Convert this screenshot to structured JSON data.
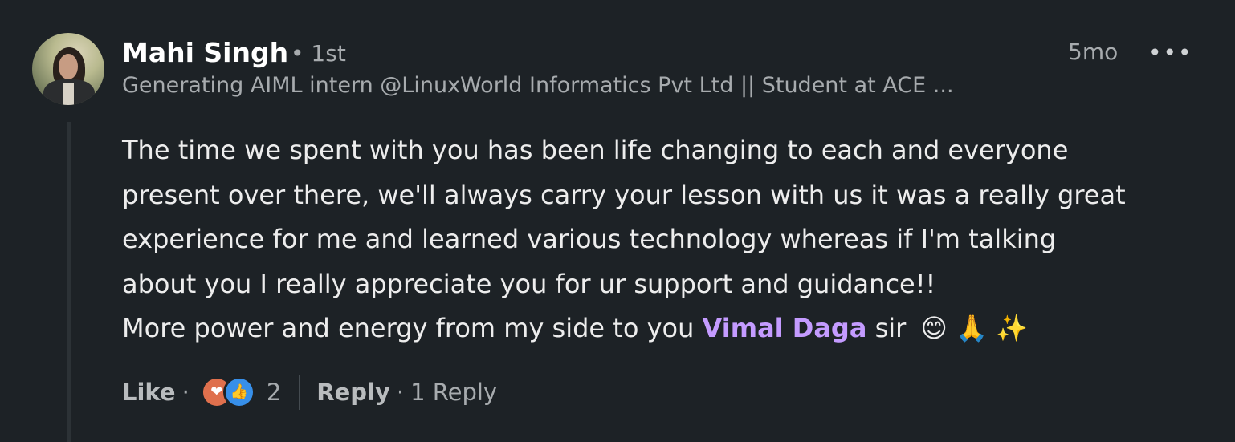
{
  "comment": {
    "author_name": "Mahi Singh",
    "degree": "• 1st",
    "headline": "Generating AIML intern @LinuxWorld Informatics Pvt Ltd || Student at ACE ...",
    "timestamp": "5mo",
    "more_label": "•••",
    "body_lines": [
      "The time we spent with you has been life changing to each and everyone",
      "present over there, we'll always carry your lesson with us it was a really great",
      "experience for me and learned various technology whereas if I'm talking",
      "about you I really appreciate you for ur support and guidance!!"
    ],
    "last_line_prefix": "More power and energy from my side to you",
    "mention": "Vimal Daga",
    "last_line_suffix": "sir",
    "emojis": "😊 🙏 ✨"
  },
  "actions": {
    "like_label": "Like",
    "separator": "·",
    "reaction_count": "2",
    "reply_label": "Reply",
    "reply_count_label": "1 Reply",
    "reaction_icons": [
      "love-icon",
      "like-icon"
    ]
  },
  "colors": {
    "background": "#1d2226",
    "mention": "#c49bff",
    "love": "#df704d",
    "like": "#378fe9"
  }
}
